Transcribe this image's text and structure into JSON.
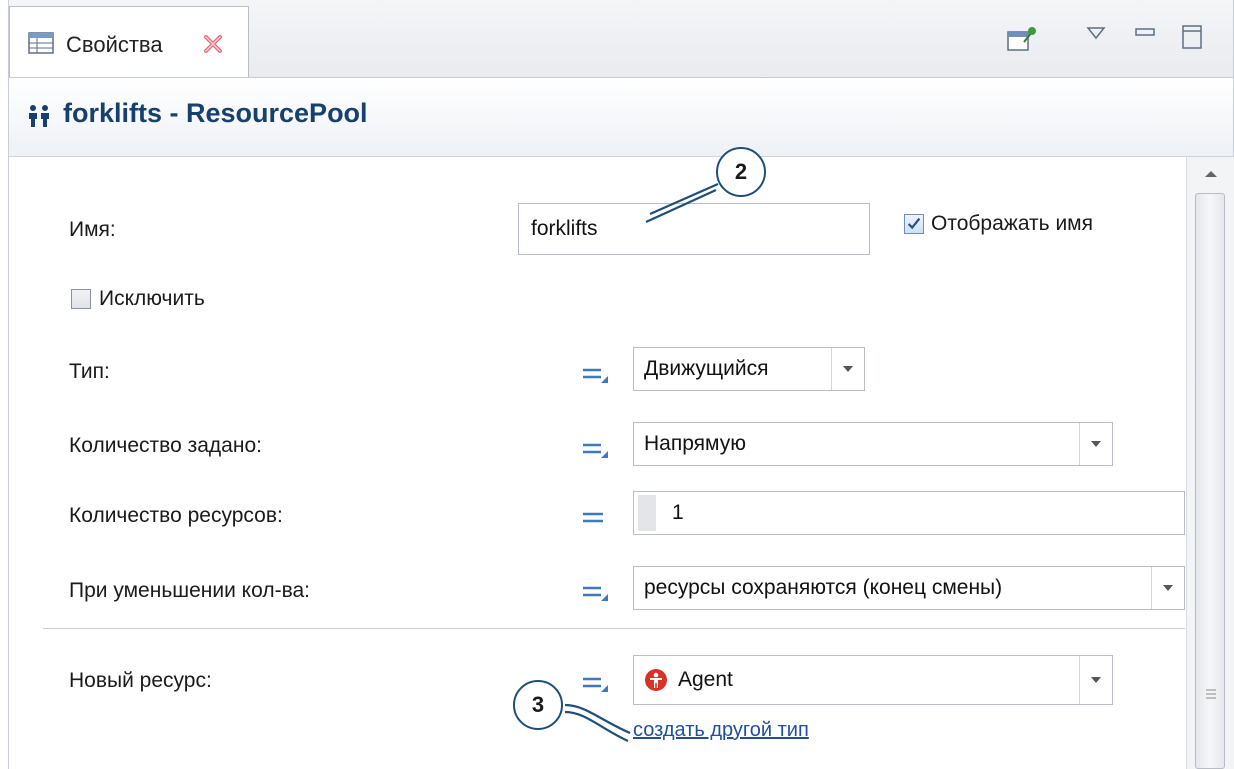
{
  "tab": {
    "label": "Свойства"
  },
  "header": {
    "title": "forklifts - ResourcePool"
  },
  "form": {
    "name_label": "Имя:",
    "name_value": "forklifts",
    "show_name_label": "Отображать имя",
    "show_name_checked": true,
    "exclude_label": "Исключить",
    "exclude_checked": false,
    "type_label": "Тип:",
    "type_value": "Движущийся",
    "quantity_defined_label": "Количество задано:",
    "quantity_defined_value": "Напрямую",
    "resource_count_label": "Количество ресурсов:",
    "resource_count_value": "1",
    "on_decrease_label": "При уменьшении кол-ва:",
    "on_decrease_value": "ресурсы сохраняются (конец смены)",
    "new_resource_label": "Новый ресурс:",
    "new_resource_value": "Agent",
    "create_type_link": "создать другой тип"
  },
  "callouts": {
    "c2": "2",
    "c3": "3"
  },
  "colors": {
    "title": "#17406d",
    "link": "#1e4f9c",
    "callout_border": "#1f4e7a",
    "agent_icon": "#d6332b"
  }
}
